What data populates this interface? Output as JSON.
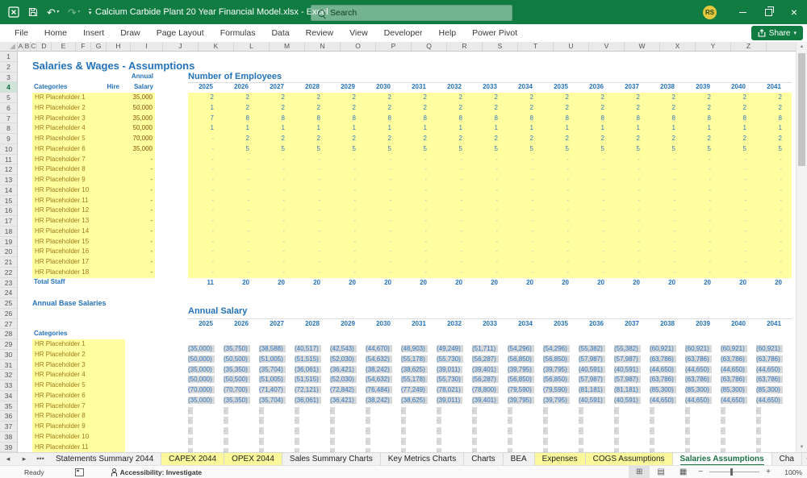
{
  "colors": {
    "titlebar_green": "#107C41",
    "accent_green": "#1E7145",
    "input_yellow": "#FFFF9F",
    "cell_gray": "#D9D9D9",
    "heading_blue": "#2472BA",
    "value_blue": "#2F77BE",
    "input_text_brown": "#A07818"
  },
  "title_bar": {
    "title": "Calcium Carbide Plant 20 Year Financial Model.xlsx  -  Excel",
    "search_placeholder": "Search",
    "avatar_initials": "RS"
  },
  "ribbon": {
    "tabs": [
      "File",
      "Home",
      "Insert",
      "Draw",
      "Page Layout",
      "Formulas",
      "Data",
      "Review",
      "View",
      "Developer",
      "Help",
      "Power Pivot"
    ],
    "share_label": "Share"
  },
  "grid": {
    "columns": [
      "A",
      "B",
      "C",
      "D",
      "E",
      "F",
      "G",
      "H",
      "I",
      "J",
      "K",
      "L",
      "M",
      "N",
      "O",
      "P",
      "Q",
      "R",
      "S",
      "T",
      "U",
      "V",
      "W",
      "X",
      "Y",
      "Z"
    ],
    "visible_rows": 39,
    "selected_row": 4
  },
  "sheet": {
    "page_title": "Salaries & Wages - Assumptions",
    "years": [
      "2025",
      "2026",
      "2027",
      "2028",
      "2029",
      "2030",
      "2031",
      "2032",
      "2033",
      "2034",
      "2035",
      "2036",
      "2037",
      "2038",
      "2039",
      "2040",
      "2041"
    ],
    "employees": {
      "title": "Number of Employees",
      "categories_header": "Categories",
      "hire_header": "Hire",
      "annual_salary_header": "Annual Salary",
      "rows": [
        {
          "name": "HR Placeholder 1",
          "salary": "35,000",
          "values": [
            "2",
            "2",
            "2",
            "2",
            "2",
            "2",
            "2",
            "2",
            "2",
            "2",
            "2",
            "2",
            "2",
            "2",
            "2",
            "2",
            "2"
          ]
        },
        {
          "name": "HR Placeholder 2",
          "salary": "50,000",
          "values": [
            "1",
            "2",
            "2",
            "2",
            "2",
            "2",
            "2",
            "2",
            "2",
            "2",
            "2",
            "2",
            "2",
            "2",
            "2",
            "2",
            "2"
          ]
        },
        {
          "name": "HR Placeholder 3",
          "salary": "35,000",
          "values": [
            "7",
            "8",
            "8",
            "8",
            "8",
            "8",
            "8",
            "8",
            "8",
            "8",
            "8",
            "8",
            "8",
            "8",
            "8",
            "8",
            "8"
          ]
        },
        {
          "name": "HR Placeholder 4",
          "salary": "50,000",
          "values": [
            "1",
            "1",
            "1",
            "1",
            "1",
            "1",
            "1",
            "1",
            "1",
            "1",
            "1",
            "1",
            "1",
            "1",
            "1",
            "1",
            "1"
          ]
        },
        {
          "name": "HR Placeholder 5",
          "salary": "70,000",
          "values": [
            "-",
            "2",
            "2",
            "2",
            "2",
            "2",
            "2",
            "2",
            "2",
            "2",
            "2",
            "2",
            "2",
            "2",
            "2",
            "2",
            "2"
          ]
        },
        {
          "name": "HR Placeholder 6",
          "salary": "35,000",
          "values": [
            "-",
            "5",
            "5",
            "5",
            "5",
            "5",
            "5",
            "5",
            "5",
            "5",
            "5",
            "5",
            "5",
            "5",
            "5",
            "5",
            "5"
          ]
        },
        {
          "name": "HR Placeholder 7",
          "salary": "-",
          "values": [
            "-",
            "-",
            "-",
            "-",
            "-",
            "-",
            "-",
            "-",
            "-",
            "-",
            "-",
            "-",
            "-",
            "-",
            "-",
            "-",
            "-"
          ]
        },
        {
          "name": "HR Placeholder 8",
          "salary": "-",
          "values": [
            "-",
            "-",
            "-",
            "-",
            "-",
            "-",
            "-",
            "-",
            "-",
            "-",
            "-",
            "-",
            "-",
            "-",
            "-",
            "-",
            "-"
          ]
        },
        {
          "name": "HR Placeholder 9",
          "salary": "-",
          "values": [
            "-",
            "-",
            "-",
            "-",
            "-",
            "-",
            "-",
            "-",
            "-",
            "-",
            "-",
            "-",
            "-",
            "-",
            "-",
            "-",
            "-"
          ]
        },
        {
          "name": "HR Placeholder 10",
          "salary": "-",
          "values": [
            "-",
            "-",
            "-",
            "-",
            "-",
            "-",
            "-",
            "-",
            "-",
            "-",
            "-",
            "-",
            "-",
            "-",
            "-",
            "-",
            "-"
          ]
        },
        {
          "name": "HR Placeholder 11",
          "salary": "-",
          "values": [
            "-",
            "-",
            "-",
            "-",
            "-",
            "-",
            "-",
            "-",
            "-",
            "-",
            "-",
            "-",
            "-",
            "-",
            "-",
            "-",
            "-"
          ]
        },
        {
          "name": "HR Placeholder 12",
          "salary": "-",
          "values": [
            "-",
            "-",
            "-",
            "-",
            "-",
            "-",
            "-",
            "-",
            "-",
            "-",
            "-",
            "-",
            "-",
            "-",
            "-",
            "-",
            "-"
          ]
        },
        {
          "name": "HR Placeholder 13",
          "salary": "-",
          "values": [
            "-",
            "-",
            "-",
            "-",
            "-",
            "-",
            "-",
            "-",
            "-",
            "-",
            "-",
            "-",
            "-",
            "-",
            "-",
            "-",
            "-"
          ]
        },
        {
          "name": "HR Placeholder 14",
          "salary": "-",
          "values": [
            "-",
            "-",
            "-",
            "-",
            "-",
            "-",
            "-",
            "-",
            "-",
            "-",
            "-",
            "-",
            "-",
            "-",
            "-",
            "-",
            "-"
          ]
        },
        {
          "name": "HR Placeholder 15",
          "salary": "-",
          "values": [
            "-",
            "-",
            "-",
            "-",
            "-",
            "-",
            "-",
            "-",
            "-",
            "-",
            "-",
            "-",
            "-",
            "-",
            "-",
            "-",
            "-"
          ]
        },
        {
          "name": "HR Placeholder 16",
          "salary": "-",
          "values": [
            "-",
            "-",
            "-",
            "-",
            "-",
            "-",
            "-",
            "-",
            "-",
            "-",
            "-",
            "-",
            "-",
            "-",
            "-",
            "-",
            "-"
          ]
        },
        {
          "name": "HR Placeholder 17",
          "salary": "-",
          "values": [
            "-",
            "-",
            "-",
            "-",
            "-",
            "-",
            "-",
            "-",
            "-",
            "-",
            "-",
            "-",
            "-",
            "-",
            "-",
            "-",
            "-"
          ]
        },
        {
          "name": "HR Placeholder 18",
          "salary": "-",
          "values": [
            "-",
            "-",
            "-",
            "-",
            "-",
            "-",
            "-",
            "-",
            "-",
            "-",
            "-",
            "-",
            "-",
            "-",
            "-",
            "-",
            "-"
          ]
        }
      ],
      "total_label": "Total Staff",
      "totals": [
        "11",
        "20",
        "20",
        "20",
        "20",
        "20",
        "20",
        "20",
        "20",
        "20",
        "20",
        "20",
        "20",
        "20",
        "20",
        "20",
        "20"
      ]
    },
    "annual_base_label": "Annual Base Salaries",
    "salary_section": {
      "title": "Annual Salary",
      "categories_header": "Categories",
      "rows": [
        {
          "name": "HR Placeholder 1",
          "values": [
            "(35,000)",
            "(35,750)",
            "(38,588)",
            "(40,517)",
            "(42,543)",
            "(44,670)",
            "(46,903)",
            "(49,249)",
            "(51,711)",
            "(54,296)",
            "(54,296)",
            "(55,382)",
            "(55,382)",
            "(60,921)",
            "(60,921)",
            "(60,921)",
            "(60,921)"
          ]
        },
        {
          "name": "HR Placeholder 2",
          "values": [
            "(50,000)",
            "(50,500)",
            "(51,005)",
            "(51,515)",
            "(52,030)",
            "(54,632)",
            "(55,178)",
            "(55,730)",
            "(56,287)",
            "(56,850)",
            "(56,850)",
            "(57,987)",
            "(57,987)",
            "(63,786)",
            "(63,786)",
            "(63,786)",
            "(63,786)"
          ]
        },
        {
          "name": "HR Placeholder 3",
          "values": [
            "(35,000)",
            "(35,350)",
            "(35,704)",
            "(36,061)",
            "(36,421)",
            "(38,242)",
            "(38,625)",
            "(39,011)",
            "(39,401)",
            "(39,795)",
            "(39,795)",
            "(40,591)",
            "(40,591)",
            "(44,650)",
            "(44,650)",
            "(44,650)",
            "(44,650)"
          ]
        },
        {
          "name": "HR Placeholder 4",
          "values": [
            "(50,000)",
            "(50,500)",
            "(51,005)",
            "(51,515)",
            "(52,030)",
            "(54,632)",
            "(55,178)",
            "(55,730)",
            "(56,287)",
            "(56,850)",
            "(56,850)",
            "(57,987)",
            "(57,987)",
            "(63,786)",
            "(63,786)",
            "(63,786)",
            "(63,786)"
          ]
        },
        {
          "name": "HR Placeholder 5",
          "values": [
            "(70,000)",
            "(70,700)",
            "(71,407)",
            "(72,121)",
            "(72,842)",
            "(76,484)",
            "(77,249)",
            "(78,021)",
            "(78,800)",
            "(79,590)",
            "(79,590)",
            "(81,181)",
            "(81,181)",
            "(85,300)",
            "(85,300)",
            "(85,300)",
            "(85,300)"
          ]
        },
        {
          "name": "HR Placeholder 6",
          "values": [
            "(35,000)",
            "(35,350)",
            "(35,704)",
            "(36,061)",
            "(36,421)",
            "(38,242)",
            "(38,625)",
            "(39,011)",
            "(39,401)",
            "(39,795)",
            "(39,795)",
            "(40,591)",
            "(40,591)",
            "(44,650)",
            "(44,650)",
            "(44,650)",
            "(44,650)"
          ]
        },
        {
          "name": "HR Placeholder 7",
          "values": [
            "-",
            "-",
            "-",
            "-",
            "-",
            "-",
            "-",
            "-",
            "-",
            "-",
            "-",
            "-",
            "-",
            "-",
            "-",
            "-",
            "-"
          ]
        },
        {
          "name": "HR Placeholder 8",
          "values": [
            "-",
            "-",
            "-",
            "-",
            "-",
            "-",
            "-",
            "-",
            "-",
            "-",
            "-",
            "-",
            "-",
            "-",
            "-",
            "-",
            "-"
          ]
        },
        {
          "name": "HR Placeholder 9",
          "values": [
            "-",
            "-",
            "-",
            "-",
            "-",
            "-",
            "-",
            "-",
            "-",
            "-",
            "-",
            "-",
            "-",
            "-",
            "-",
            "-",
            "-"
          ]
        },
        {
          "name": "HR Placeholder 10",
          "values": [
            "-",
            "-",
            "-",
            "-",
            "-",
            "-",
            "-",
            "-",
            "-",
            "-",
            "-",
            "-",
            "-",
            "-",
            "-",
            "-",
            "-"
          ]
        },
        {
          "name": "HR Placeholder 11",
          "values": [
            "-",
            "-",
            "-",
            "-",
            "-",
            "-",
            "-",
            "-",
            "-",
            "-",
            "-",
            "-",
            "-",
            "-",
            "-",
            "-",
            "-"
          ]
        }
      ]
    }
  },
  "sheet_tabs": {
    "tabs": [
      {
        "label": "Statements Summary 2044",
        "state": "plain"
      },
      {
        "label": "CAPEX 2044",
        "state": "yellow"
      },
      {
        "label": "OPEX 2044",
        "state": "yellow"
      },
      {
        "label": "Sales Summary Charts",
        "state": "plain"
      },
      {
        "label": "Key Metrics Charts",
        "state": "plain"
      },
      {
        "label": "Charts",
        "state": "plain"
      },
      {
        "label": "BEA",
        "state": "plain"
      },
      {
        "label": "Expenses",
        "state": "yellow"
      },
      {
        "label": "COGS Assumptions",
        "state": "yellow"
      },
      {
        "label": "Salaries Assumptions",
        "state": "active"
      },
      {
        "label": "Cha",
        "state": "plain"
      }
    ]
  },
  "status_bar": {
    "ready": "Ready",
    "accessibility": "Accessibility: Investigate",
    "zoom": "100%"
  }
}
